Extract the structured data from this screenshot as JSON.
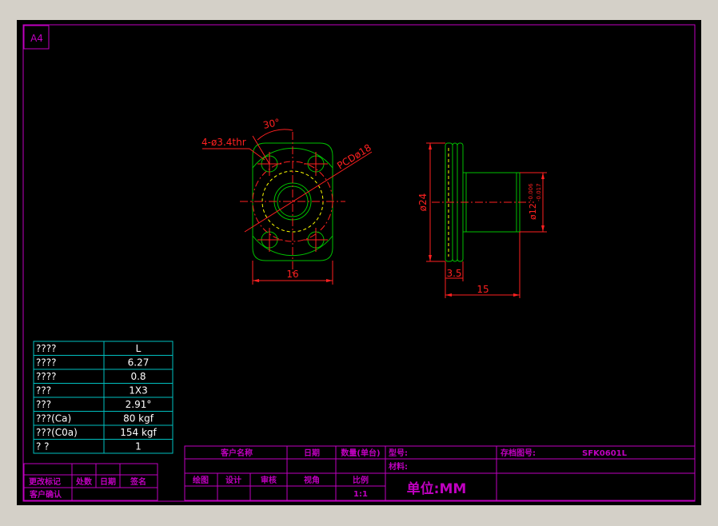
{
  "sheet": {
    "size_label": "A4"
  },
  "colors": {
    "background": "#000000",
    "frame": "#c000c0",
    "part_outline": "#00c000",
    "dimension": "#ff2020",
    "centerline": "#ff2020",
    "hidden": "#ffff00",
    "table": "#00c0c0",
    "table_text": "#ffffff"
  },
  "drawing": {
    "front_view": {
      "angle_dim": "30°",
      "hole_callout": "4-ø3.4thr",
      "pcd_label": "PCDø18",
      "width_dim": "16"
    },
    "side_view": {
      "flange_dia_dim": "ø24",
      "shaft_dia_dim": "ø12",
      "tol_upper": "-0.006",
      "tol_lower": "-0.017",
      "flange_thk_dim": "3.5",
      "length_dim": "15"
    }
  },
  "spec_table": {
    "rows": [
      {
        "label": "????",
        "value": "L"
      },
      {
        "label": "????",
        "value": "6.27"
      },
      {
        "label": "????",
        "value": "0.8"
      },
      {
        "label": "???",
        "value": "1X3"
      },
      {
        "label": "???",
        "value": "2.91°"
      },
      {
        "label": "???(Ca)",
        "value": "80  kgf"
      },
      {
        "label": "???(C0a)",
        "value": "154  kgf"
      },
      {
        "label": "?   ?",
        "value": "1"
      }
    ]
  },
  "revision_block": {
    "change_mark": "更改标记",
    "location": "处数",
    "date": "日期",
    "signature": "签名",
    "customer_confirm": "客户确认"
  },
  "title_block": {
    "customer_name": "客户名称",
    "date": "日期",
    "qty": "数量(单台)",
    "model_label": "型号:",
    "drawing_no_label": "存档图号:",
    "drawing_no": "SFK0601L",
    "material_label": "材料:",
    "drawn": "绘图",
    "design": "设计",
    "review": "审核",
    "view_angle": "视角",
    "scale_label": "比例",
    "scale": "1:1",
    "unit": "单位:MM"
  }
}
